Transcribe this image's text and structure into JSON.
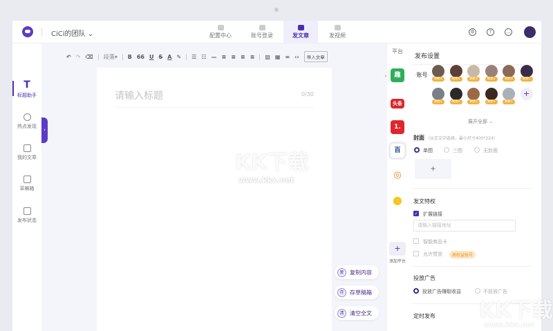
{
  "header": {
    "team": "CiCi的团队",
    "tabs": [
      {
        "label": "配置中心"
      },
      {
        "label": "账号登录"
      },
      {
        "label": "发文章",
        "active": true
      },
      {
        "label": "发视频"
      }
    ]
  },
  "sidebar": {
    "items": [
      {
        "label": "标题助手",
        "icon": "T"
      },
      {
        "label": "热点发现"
      },
      {
        "label": "我的文章"
      },
      {
        "label": "草稿箱"
      },
      {
        "label": "发布状态"
      }
    ]
  },
  "toolbar": {
    "paragraph": "段落",
    "bold": "B",
    "quote": "66",
    "underline": "U",
    "strike": "S",
    "font_color": "A",
    "import": "导入文章"
  },
  "editor": {
    "title_placeholder": "请输入标题",
    "count": "0/30"
  },
  "float_actions": [
    {
      "icon": "复",
      "label": "复制内容"
    },
    {
      "icon": "存",
      "label": "存草稿箱"
    },
    {
      "icon": "清",
      "label": "清空全文"
    }
  ],
  "platforms": {
    "header": "平台",
    "items": [
      {
        "text": "趣",
        "color": "#2fae5a"
      },
      {
        "text": "头条",
        "color": "#e0262b"
      },
      {
        "text": "1.",
        "color": "#e0262b"
      },
      {
        "text": "百",
        "color": "#1a3b8a"
      },
      {
        "text": "◎",
        "color": "#f07a1a"
      },
      {
        "text": "●",
        "color": "#f7c520"
      }
    ],
    "add": "添加平台"
  },
  "panel": {
    "title": "发布设置",
    "account_label": "账号",
    "accounts": [
      "剩余4",
      "剩余4",
      "剩余3",
      "剩余2",
      "剩余1",
      "剩余1",
      "剩余1",
      "剩余1",
      "剩余1",
      "剩余1",
      "剩余1"
    ],
    "expand": "展开全部",
    "cover_label": "封面",
    "cover_hint": "（从正文中选择，最小尺寸400*224）",
    "cover_options": [
      "单图",
      "三图",
      "无封面"
    ],
    "privilege_label": "发文特权",
    "ext_link": "扩展链接",
    "link_placeholder": "请输入链接地址",
    "smart_card": "智能商品卡",
    "allow_reward": "允许赞赏",
    "reward_tag": "高权益账号",
    "ad_label": "投放广告",
    "ad_options": [
      "投放广告赚取收益",
      "不投放广告"
    ],
    "schedule_label": "定时发布"
  },
  "watermark": {
    "brand": "KK下载",
    "url": "www.kkx.net"
  }
}
